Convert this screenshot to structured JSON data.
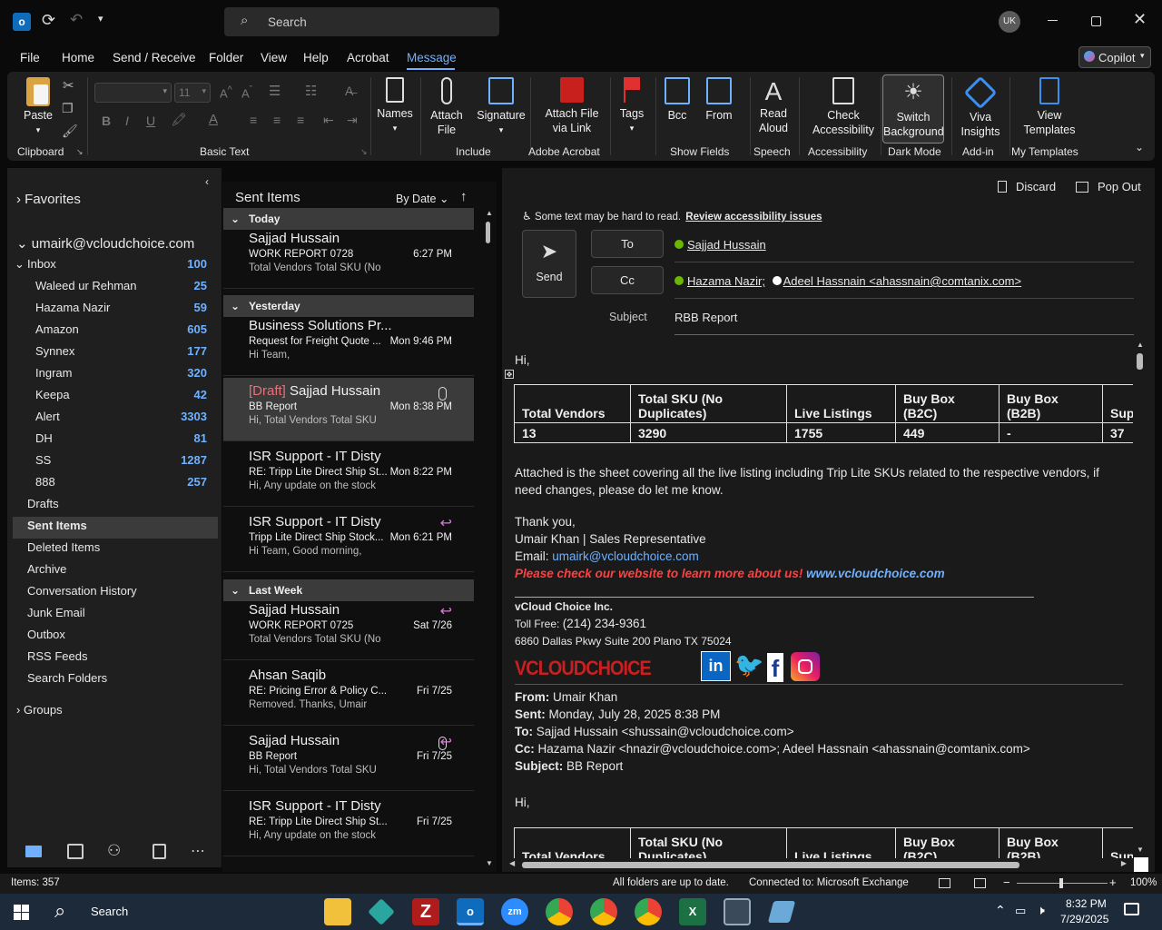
{
  "titlebar": {
    "search_placeholder": "Search",
    "user_initials": "UK",
    "copilot": "Copilot"
  },
  "menu": [
    "File",
    "Home",
    "Send / Receive",
    "Folder",
    "View",
    "Help",
    "Acrobat",
    "Message"
  ],
  "ribbon": {
    "paste": "Paste",
    "clipboard": "Clipboard",
    "font_size": "11",
    "basic_text": "Basic Text",
    "names": "Names",
    "attach_file": "Attach File",
    "signature": "Signature",
    "include": "Include",
    "attach_link_1": "Attach File",
    "attach_link_2": "via Link",
    "adobe": "Adobe Acrobat",
    "tags": "Tags",
    "bcc": "Bcc",
    "from": "From",
    "show_fields": "Show Fields",
    "read_aloud_1": "Read",
    "read_aloud_2": "Aloud",
    "speech": "Speech",
    "check_1": "Check",
    "check_2": "Accessibility",
    "accessibility": "Accessibility",
    "switch_1": "Switch",
    "switch_2": "Background",
    "dark_mode": "Dark Mode",
    "viva_1": "Viva",
    "viva_2": "Insights",
    "addin": "Add-in",
    "view_1": "View",
    "view_2": "Templates",
    "my_templates": "My Templates"
  },
  "folders": {
    "favorites": "Favorites",
    "account": "umairk@vcloudchoice.com",
    "inbox": {
      "label": "Inbox",
      "count": "100"
    },
    "subfolders": [
      {
        "label": "Waleed ur Rehman",
        "count": "25"
      },
      {
        "label": "Hazama Nazir",
        "count": "59"
      },
      {
        "label": "Amazon",
        "count": "605"
      },
      {
        "label": "Synnex",
        "count": "177"
      },
      {
        "label": "Ingram",
        "count": "320"
      },
      {
        "label": "Keepa",
        "count": "42"
      },
      {
        "label": "Alert",
        "count": "3303"
      },
      {
        "label": "DH",
        "count": "81"
      },
      {
        "label": "SS",
        "count": "1287"
      },
      {
        "label": "888",
        "count": "257"
      }
    ],
    "others": [
      "Drafts",
      "Sent Items",
      "Deleted Items",
      "Archive",
      "Conversation History",
      "Junk Email",
      "Outbox",
      "RSS Feeds",
      "Search Folders"
    ],
    "groups": "Groups"
  },
  "list": {
    "title": "Sent Items",
    "sort": "By Date",
    "g_today": "Today",
    "g_yesterday": "Yesterday",
    "g_lastweek": "Last Week",
    "items": [
      {
        "sender": "Sajjad Hussain",
        "subject": "WORK REPORT 0728",
        "time": "6:27 PM",
        "preview": "Total Vendors  Total SKU (No"
      },
      {
        "sender": "Business Solutions Pr...",
        "subject": "Request for Freight Quote ...",
        "time": "Mon 9:46 PM",
        "preview": "Hi Team,"
      },
      {
        "draft": "[Draft]",
        "sender": "Sajjad Hussain",
        "subject": "BB Report",
        "time": "Mon 8:38 PM",
        "preview": "Hi,  Total Vendors  Total SKU"
      },
      {
        "sender": "ISR Support - IT Disty",
        "subject": "RE: Tripp Lite Direct Ship St...",
        "time": "Mon 8:22 PM",
        "preview": "Hi,  Any update on the stock"
      },
      {
        "sender": "ISR Support - IT Disty",
        "subject": "Tripp Lite Direct Ship Stock...",
        "time": "Mon 6:21 PM",
        "preview": "Hi Team,  Good morning,"
      },
      {
        "sender": "Sajjad Hussain",
        "subject": "WORK REPORT 0725",
        "time": "Sat 7/26",
        "preview": "Total Vendors  Total SKU (No"
      },
      {
        "sender": "Ahsan Saqib",
        "subject": "RE: Pricing Error & Policy C...",
        "time": "Fri 7/25",
        "preview": "Removed.  Thanks,  Umair"
      },
      {
        "sender": "Sajjad Hussain",
        "subject": "BB Report",
        "time": "Fri 7/25",
        "preview": "Hi,  Total Vendors  Total SKU"
      },
      {
        "sender": "ISR Support - IT Disty",
        "subject": "RE: Tripp Lite Direct Ship St...",
        "time": "Fri 7/25",
        "preview": "Hi,  Any update on the stock"
      }
    ]
  },
  "compose": {
    "discard": "Discard",
    "popout": "Pop Out",
    "access_warn": "Some text may be hard to read.",
    "access_link": "Review accessibility issues",
    "send": "Send",
    "to_btn": "To",
    "cc_btn": "Cc",
    "subject_label": "Subject",
    "to": "Sajjad Hussain",
    "cc1": "Hazama Nazir;",
    "cc2": "Adeel Hassnain <ahassnain@comtanix.com>",
    "subject": "RBB Report"
  },
  "body": {
    "hi": "Hi,",
    "headers": [
      "Total Vendors",
      "Total SKU (No Duplicates)",
      "Live Listings",
      "Buy Box (B2C)",
      "Buy Box (B2B)",
      "Sup"
    ],
    "values": [
      "13",
      "3290",
      "1755",
      "449",
      "-",
      "37"
    ],
    "para": "Attached is the sheet covering all the live listing including Trip Lite SKUs related to the respective vendors, if need changes, please do let me know.",
    "thanks": "Thank you,",
    "sig_name": "Umair Khan | Sales Representative",
    "email_label": "Email: ",
    "email": "umairk@vcloudchoice.com",
    "promo": "Please check our website to learn more about us! ",
    "website": "www.vcloudchoice.com",
    "company": "vCloud Choice Inc.",
    "tollfree_label": "Toll Free: ",
    "tollfree": "(214) 234-9361",
    "address": "6860 Dallas Pkwy Suite 200 Plano TX 75024",
    "logo": "VCLOUDCHOICE",
    "from_label": "From:",
    "from": "Umair Khan",
    "sent_label": "Sent:",
    "sent": "Monday, July 28, 2025 8:38 PM",
    "to_label": "To:",
    "to": "Sajjad Hussain <shussain@vcloudchoice.com>",
    "cc_label": "Cc:",
    "cc": "Hazama Nazir <hnazir@vcloudchoice.com>; Adeel Hassnain <ahassnain@comtanix.com>",
    "subject_label": "Subject:",
    "subject": "BB Report",
    "hi2": "Hi,",
    "h2": [
      "Total Vendors",
      "Total SKU (No Duplicates)",
      "Live Listings",
      "Buy Box (B2C)",
      "Buy Box (B2B)",
      "Sup"
    ]
  },
  "status": {
    "items": "Items: 357",
    "uptodate": "All folders are up to date.",
    "connected": "Connected to: Microsoft Exchange",
    "zoom": "100%"
  },
  "taskbar": {
    "search": "Search",
    "time": "8:32 PM",
    "date": "7/29/2025"
  }
}
